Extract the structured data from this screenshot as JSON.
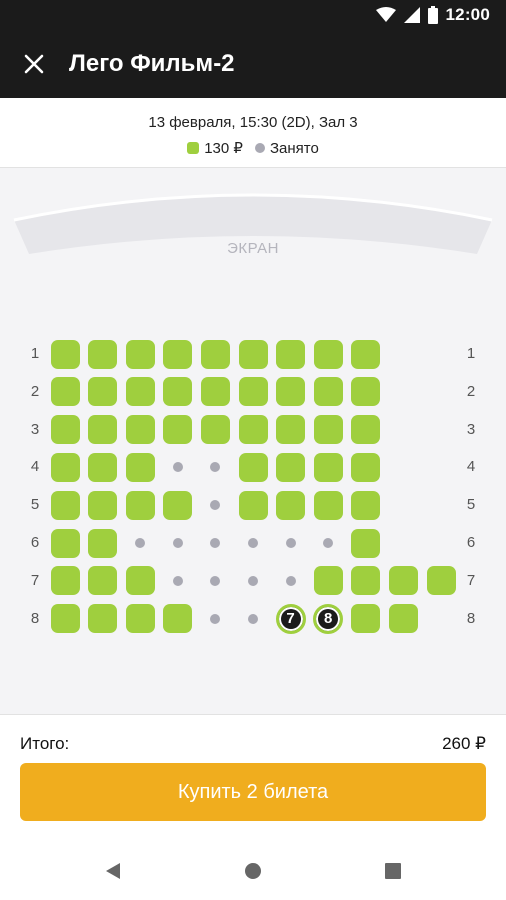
{
  "status_bar": {
    "time": "12:00",
    "icons": [
      "wifi-icon",
      "signal-icon",
      "battery-icon"
    ]
  },
  "header": {
    "title": "Лего Фильм-2",
    "close_icon": "close-icon"
  },
  "session": {
    "info": "13 февраля, 15:30 (2D), Зал 3",
    "legend_price": "130 ₽",
    "legend_taken": "Занято"
  },
  "screen_label": "ЭКРАН",
  "seat_map": {
    "rows": [
      {
        "number": "1",
        "seats": [
          "a",
          "a",
          "a",
          "a",
          "a",
          "a",
          "a",
          "a",
          "a"
        ]
      },
      {
        "number": "2",
        "seats": [
          "a",
          "a",
          "a",
          "a",
          "a",
          "a",
          "a",
          "a",
          "a"
        ]
      },
      {
        "number": "3",
        "seats": [
          "a",
          "a",
          "a",
          "a",
          "a",
          "a",
          "a",
          "a",
          "a"
        ]
      },
      {
        "number": "4",
        "seats": [
          "a",
          "a",
          "a",
          "t",
          "t",
          "a",
          "a",
          "a",
          "a"
        ]
      },
      {
        "number": "5",
        "seats": [
          "a",
          "a",
          "a",
          "a",
          "t",
          "a",
          "a",
          "a",
          "a"
        ]
      },
      {
        "number": "6",
        "seats": [
          "a",
          "a",
          "t",
          "t",
          "t",
          "t",
          "t",
          "t",
          "a"
        ]
      },
      {
        "number": "7",
        "seats": [
          "a",
          "a",
          "a",
          "t",
          "t",
          "t",
          "t",
          "a",
          "a",
          "a",
          "a"
        ]
      },
      {
        "number": "8",
        "seats": [
          "a",
          "a",
          "a",
          "a",
          "t",
          "t",
          "s7",
          "s8",
          "a",
          "a"
        ]
      }
    ],
    "selected_seats": [
      "7",
      "8"
    ]
  },
  "footer": {
    "total_label": "Итого:",
    "total_value": "260 ₽",
    "buy_button": "Купить 2 билета"
  },
  "colors": {
    "available": "#9fcf3e",
    "taken": "#a9a9b3",
    "accent": "#f0ad1e",
    "header_bg": "#1b1b1b"
  },
  "nav_bar": {
    "icons": [
      "back-icon",
      "home-icon",
      "recents-icon"
    ]
  }
}
